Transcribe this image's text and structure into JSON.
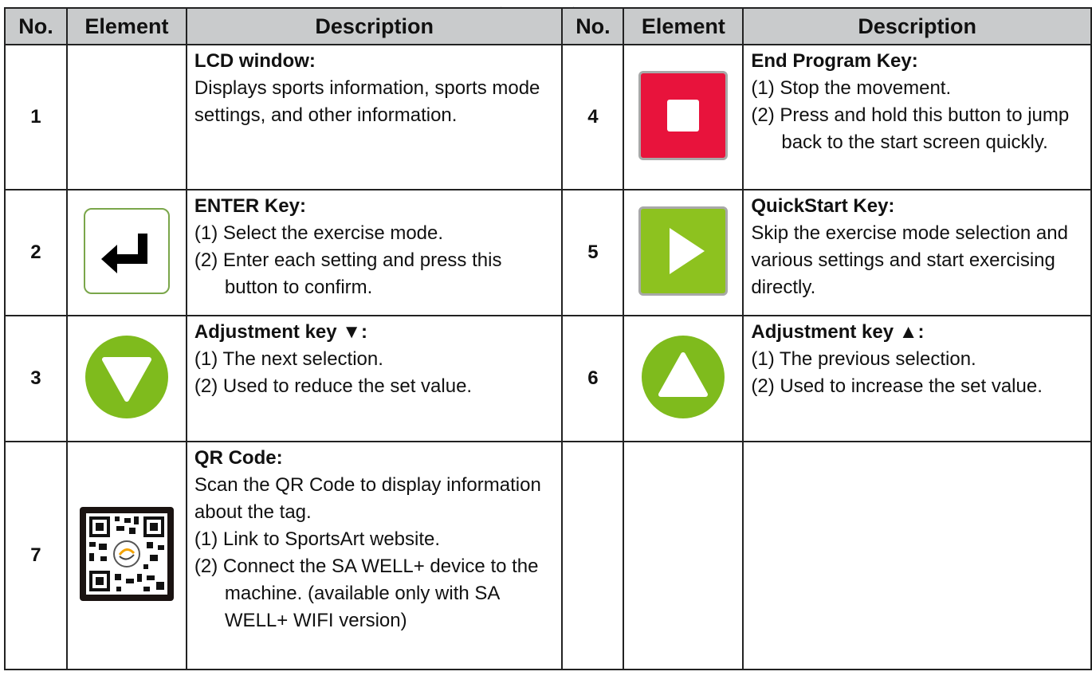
{
  "headers": {
    "no": "No.",
    "element": "Element",
    "description": "Description"
  },
  "rows": [
    {
      "left": {
        "no": "1",
        "icon": "none",
        "title": "LCD window:",
        "lines": [
          "Displays sports information, sports mode settings, and other information."
        ]
      },
      "right": {
        "no": "4",
        "icon": "stop-icon",
        "title": "End Program Key:",
        "lines": [
          "(1) Stop the movement.",
          "(2) Press and hold this button to jump back to the start screen quickly."
        ]
      }
    },
    {
      "left": {
        "no": "2",
        "icon": "enter-arrow-icon",
        "title": "ENTER Key:",
        "lines": [
          "(1) Select the exercise mode.",
          "(2) Enter each setting and press this button to confirm."
        ]
      },
      "right": {
        "no": "5",
        "icon": "play-icon",
        "title": "QuickStart Key:",
        "lines": [
          "Skip the exercise mode selection and various settings and start exercising directly."
        ]
      }
    },
    {
      "left": {
        "no": "3",
        "icon": "down-triangle-icon",
        "title": "Adjustment key ▼:",
        "lines": [
          "(1) The next selection.",
          "(2) Used to reduce the set value."
        ]
      },
      "right": {
        "no": "6",
        "icon": "up-triangle-icon",
        "title": "Adjustment key ▲:",
        "lines": [
          "(1) The previous selection.",
          "(2) Used to increase the set value."
        ]
      }
    },
    {
      "left": {
        "no": "7",
        "icon": "qr-code-icon",
        "title": "QR Code:",
        "lines": [
          "Scan the QR Code to display information about the tag.",
          "(1) Link to SportsArt website.",
          "(2) Connect the SA WELL+ device to the machine. (available only with SA WELL+ WIFI version)"
        ]
      }
    }
  ],
  "colors": {
    "header_bg": "#c9cbcc",
    "end_key_red": "#e8133c",
    "quickstart_green": "#8dc21f",
    "adjust_green": "#7fbb1d",
    "enter_border_green": "#7aa64a"
  }
}
